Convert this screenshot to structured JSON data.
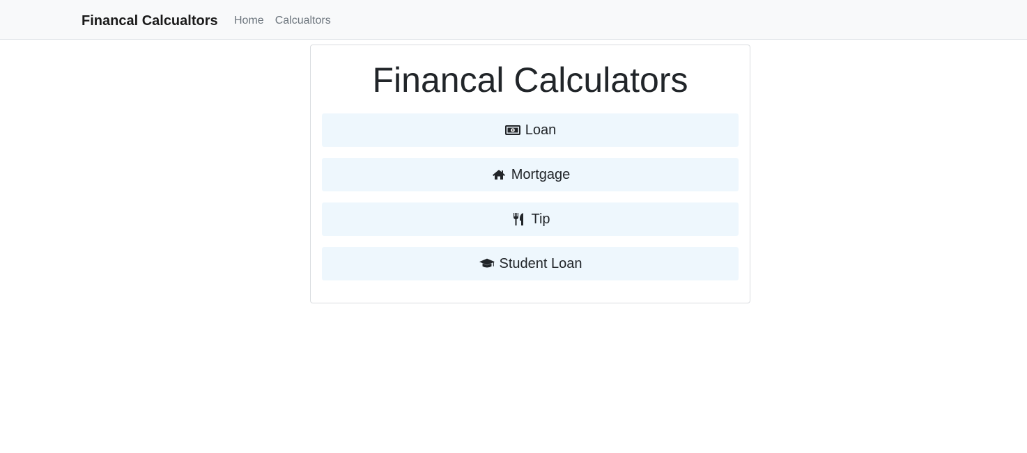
{
  "navbar": {
    "brand": "Financal Calcualtors",
    "links": [
      {
        "label": "Home"
      },
      {
        "label": "Calcualtors"
      }
    ]
  },
  "main": {
    "title": "Financal Calculators",
    "buttons": [
      {
        "label": "Loan",
        "icon": "money-bill-icon"
      },
      {
        "label": "Mortgage",
        "icon": "home-icon"
      },
      {
        "label": "Tip",
        "icon": "utensils-icon"
      },
      {
        "label": "Student Loan",
        "icon": "graduation-cap-icon"
      }
    ]
  },
  "colors": {
    "navbar_bg": "#f8f9fa",
    "button_bg": "#eef7fd",
    "text": "#212529",
    "nav_link": "#6c757d"
  }
}
